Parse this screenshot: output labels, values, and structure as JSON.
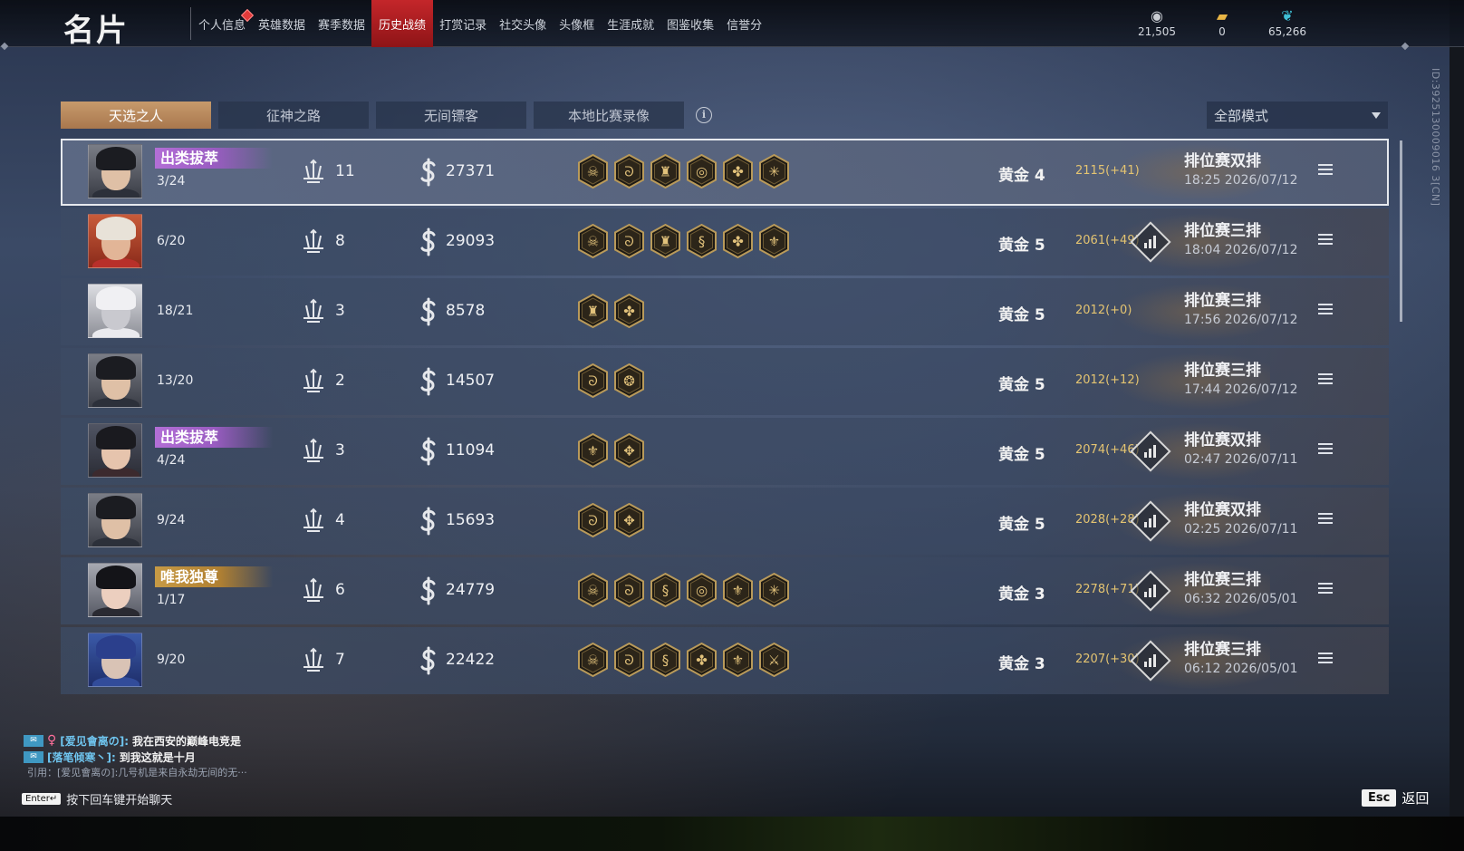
{
  "header": {
    "title": "名片",
    "nav": [
      {
        "label": "个人信息",
        "badge": true
      },
      {
        "label": "英雄数据"
      },
      {
        "label": "赛季数据"
      },
      {
        "label": "历史战绩",
        "active": true
      },
      {
        "label": "打赏记录"
      },
      {
        "label": "社交头像"
      },
      {
        "label": "头像框"
      },
      {
        "label": "生涯成就"
      },
      {
        "label": "图鉴收集"
      },
      {
        "label": "信誉分"
      }
    ],
    "currencies": [
      {
        "icon": "coin-icon",
        "value": "21,505"
      },
      {
        "icon": "ticket-icon",
        "value": "0"
      },
      {
        "icon": "feather-icon",
        "value": "65,266"
      }
    ]
  },
  "side_id": "ID:3925130009016 3[CN]",
  "tabs": [
    {
      "label": "天选之人",
      "active": true
    },
    {
      "label": "征神之路"
    },
    {
      "label": "无间镖客"
    },
    {
      "label": "本地比赛录像"
    }
  ],
  "mode_filter": {
    "value": "全部模式"
  },
  "matches": [
    {
      "avatar": "a",
      "title": "出类拔萃",
      "title_style": "purple",
      "kda": "3/24",
      "kills": "11",
      "score": "27371",
      "items": [
        "demon",
        "swirl",
        "banner",
        "orb",
        "fan",
        "star"
      ],
      "rank": "黄金 4",
      "mmr": "2115(+41)",
      "detail": false,
      "mode": "排位赛双排",
      "time": "18:25  2026/07/12",
      "selected": true
    },
    {
      "avatar": "b",
      "title": "",
      "kda": "6/20",
      "kills": "8",
      "score": "29093",
      "items": [
        "demon",
        "swirl",
        "banner",
        "dragon",
        "fan",
        "lotus"
      ],
      "rank": "黄金 5",
      "mmr": "2061(+49)",
      "detail": true,
      "mode": "排位赛三排",
      "time": "18:04  2026/07/12"
    },
    {
      "avatar": "c",
      "title": "",
      "kda": "18/21",
      "kills": "3",
      "score": "8578",
      "items": [
        "banner",
        "fan"
      ],
      "rank": "黄金 5",
      "mmr": "2012(+0)",
      "detail": false,
      "mode": "排位赛三排",
      "time": "17:56  2026/07/12"
    },
    {
      "avatar": "a",
      "title": "",
      "kda": "13/20",
      "kills": "2",
      "score": "14507",
      "items": [
        "swirl",
        "wings"
      ],
      "rank": "黄金 5",
      "mmr": "2012(+12)",
      "detail": false,
      "mode": "排位赛三排",
      "time": "17:44  2026/07/12"
    },
    {
      "avatar": "d",
      "title": "出类拔萃",
      "title_style": "purple",
      "kda": "4/24",
      "kills": "3",
      "score": "11094",
      "items": [
        "lotus",
        "triad"
      ],
      "rank": "黄金 5",
      "mmr": "2074(+46)",
      "detail": true,
      "mode": "排位赛双排",
      "time": "02:47  2026/07/11"
    },
    {
      "avatar": "a",
      "title": "",
      "kda": "9/24",
      "kills": "4",
      "score": "15693",
      "items": [
        "swirl",
        "triad"
      ],
      "rank": "黄金 5",
      "mmr": "2028(+28)",
      "detail": true,
      "mode": "排位赛双排",
      "time": "02:25  2026/07/11"
    },
    {
      "avatar": "e",
      "title": "唯我独尊",
      "title_style": "gold",
      "kda": "1/17",
      "kills": "6",
      "score": "24779",
      "items": [
        "demon",
        "swirl",
        "dragon",
        "orb",
        "lotus",
        "star"
      ],
      "rank": "黄金 3",
      "mmr": "2278(+71)",
      "detail": true,
      "mode": "排位赛三排",
      "time": "06:32  2026/05/01"
    },
    {
      "avatar": "f",
      "title": "",
      "kda": "9/20",
      "kills": "7",
      "score": "22422",
      "items": [
        "demon",
        "swirl",
        "dragon",
        "fan",
        "lotus",
        "sword"
      ],
      "rank": "黄金 3",
      "mmr": "2207(+30)",
      "detail": true,
      "mode": "排位赛三排",
      "time": "06:12  2026/05/01"
    }
  ],
  "chat": {
    "lines": [
      {
        "name": "[爱见會离の]:",
        "text": "我在西安的巅峰电竞是",
        "female": true
      },
      {
        "name": "[落笔倾寒丶]:",
        "text": "到我这就是十月",
        "female": false
      }
    ],
    "quote": "引用：[爱见會离の]:几号机是来自永劫无间的无···",
    "enter_key": "Enter↵",
    "enter_hint": "按下回车键开始聊天"
  },
  "footer": {
    "esc_key": "Esc",
    "back_label": "返回"
  }
}
